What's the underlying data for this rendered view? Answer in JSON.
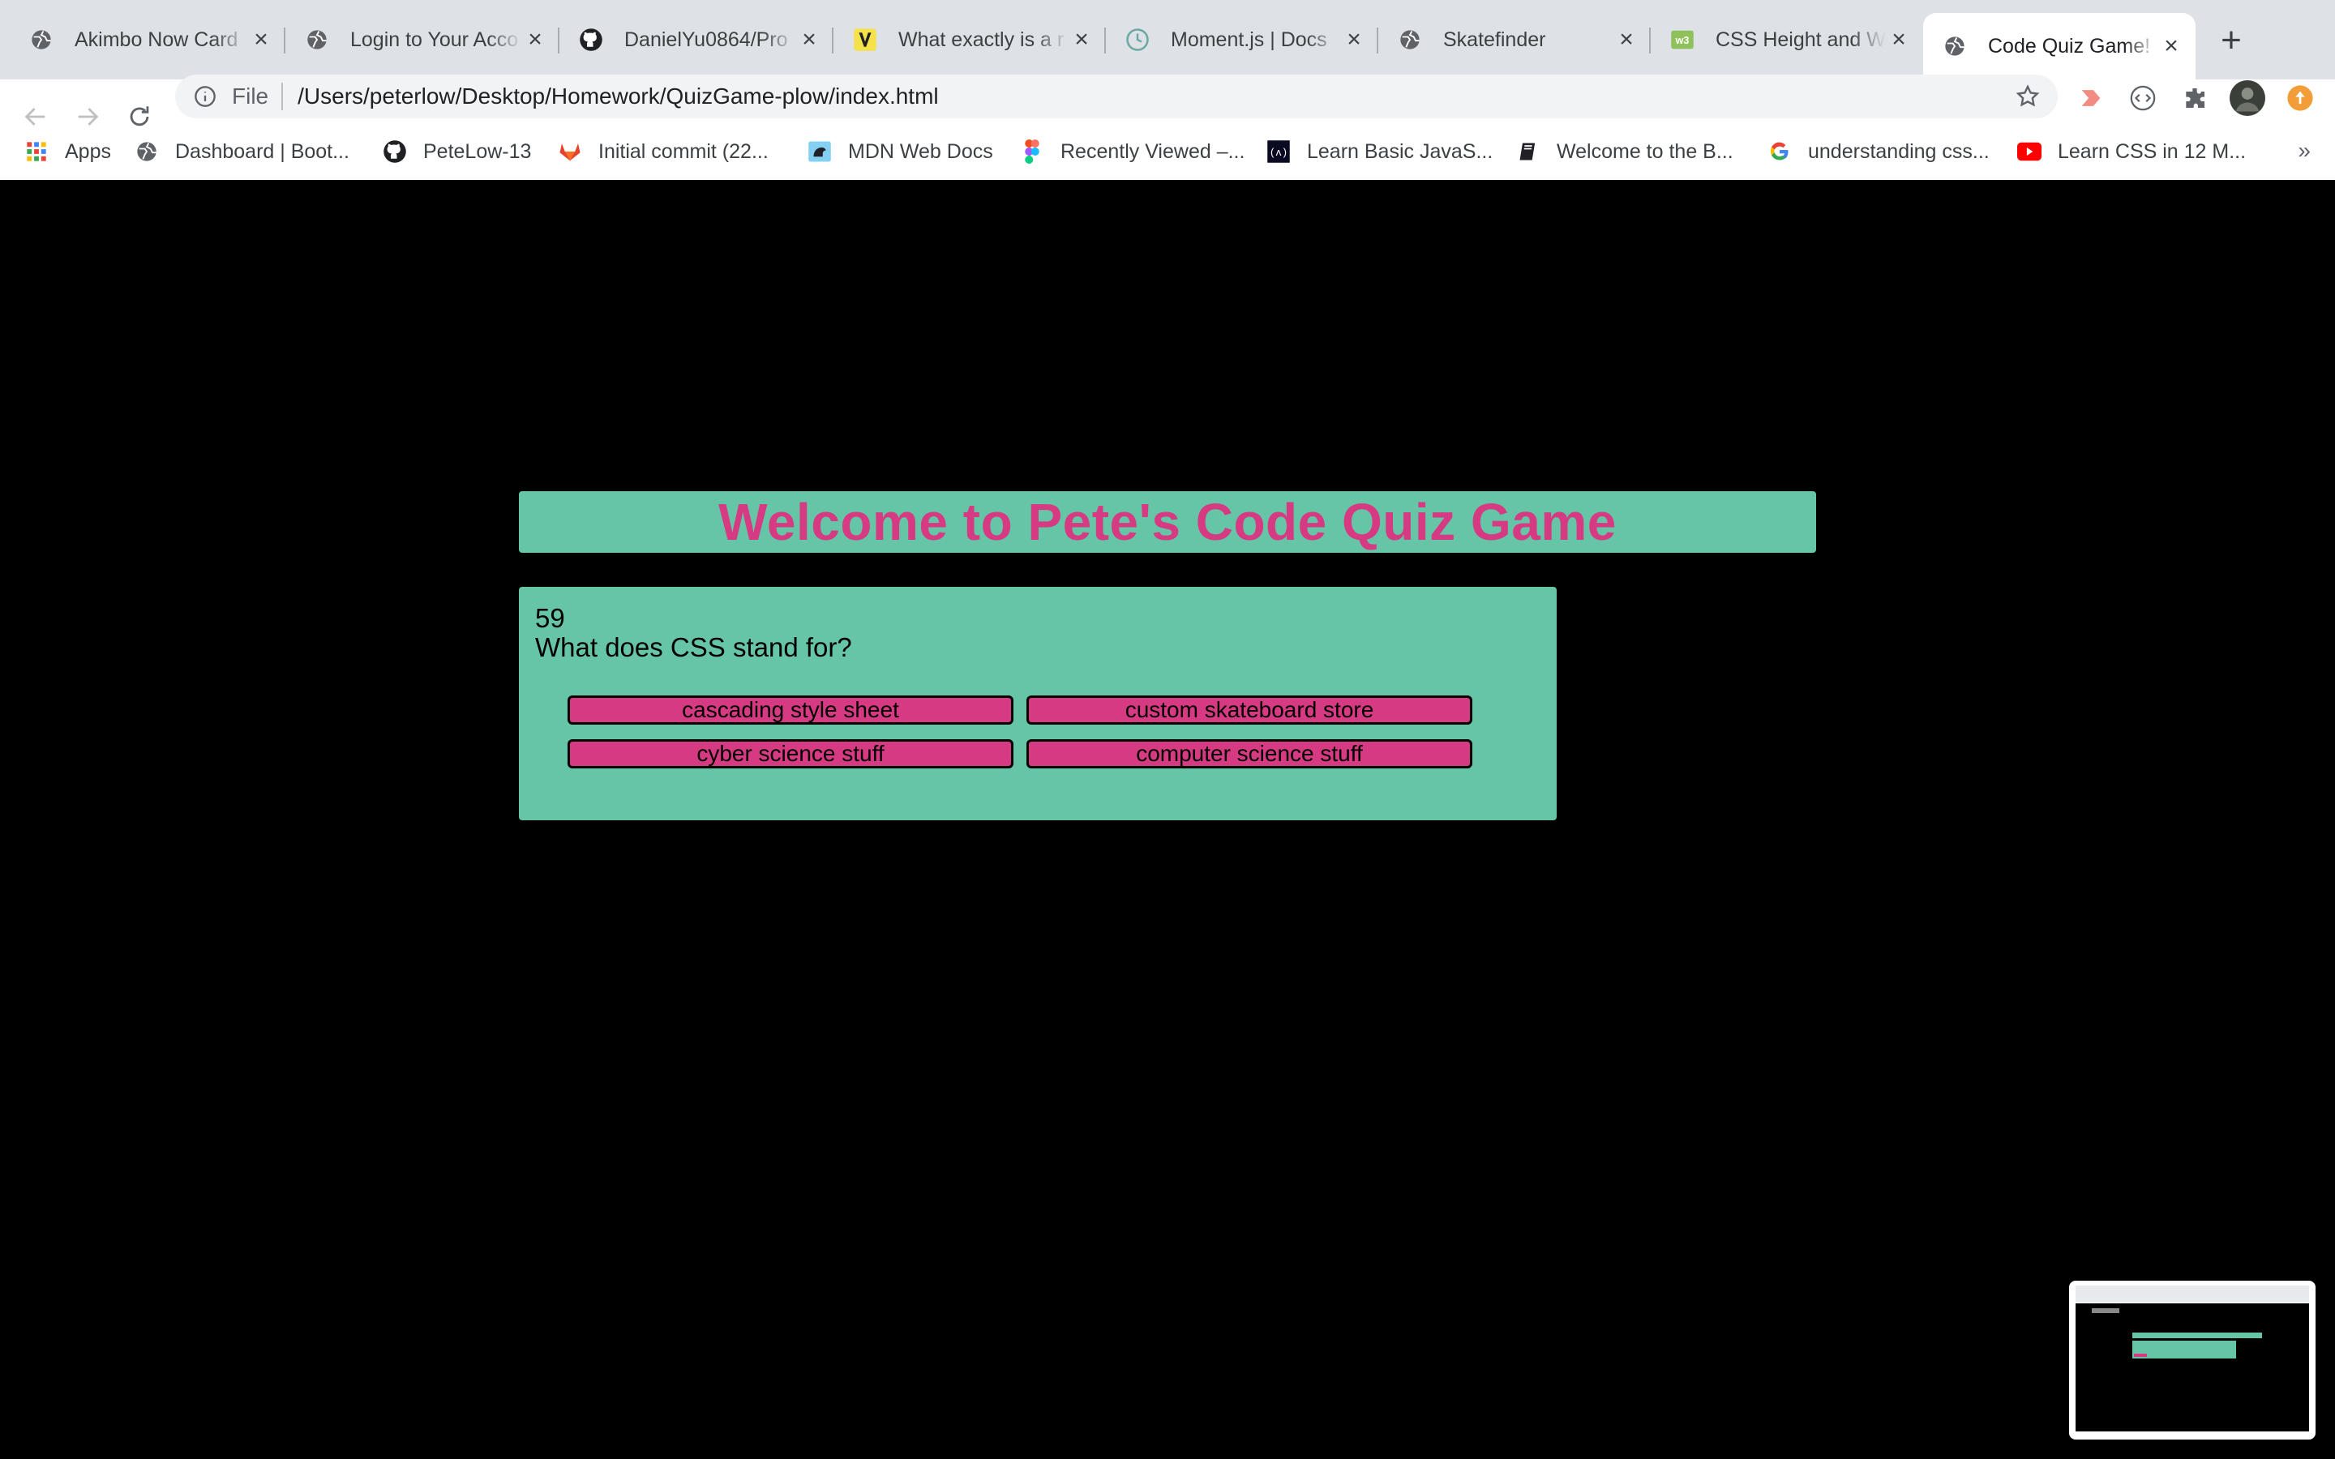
{
  "browser": {
    "tabs": [
      {
        "title": "Akimbo Now Card",
        "favicon": "globe-icon"
      },
      {
        "title": "Login to Your Acco",
        "favicon": "globe-icon"
      },
      {
        "title": "DanielYu0864/Pro",
        "favicon": "github-icon"
      },
      {
        "title": "What exactly is a r",
        "favicon": "v-icon"
      },
      {
        "title": "Moment.js | Docs",
        "favicon": "clock-icon"
      },
      {
        "title": "Skatefinder",
        "favicon": "globe-icon"
      },
      {
        "title": "CSS Height and W",
        "favicon": "w3-icon"
      },
      {
        "title": "Code Quiz Game!",
        "favicon": "globe-icon"
      }
    ],
    "address": {
      "scheme_label": "File",
      "url": "/Users/peterlow/Desktop/Homework/QuizGame-plow/index.html"
    },
    "bookmarks": [
      {
        "label": "Apps",
        "icon": "apps-grid-icon"
      },
      {
        "label": "Dashboard | Boot...",
        "icon": "globe-icon"
      },
      {
        "label": "PeteLow-13",
        "icon": "github-icon"
      },
      {
        "label": "Initial commit (22...",
        "icon": "gitlab-icon"
      },
      {
        "label": "MDN Web Docs",
        "icon": "mdn-icon"
      },
      {
        "label": "Recently Viewed –...",
        "icon": "figma-icon"
      },
      {
        "label": "Learn Basic JavaS...",
        "icon": "freecodecamp-icon"
      },
      {
        "label": "Welcome to the B...",
        "icon": "book-icon"
      },
      {
        "label": "understanding css...",
        "icon": "google-icon"
      },
      {
        "label": "Learn CSS in 12 M...",
        "icon": "youtube-icon"
      }
    ],
    "bookmarks_more": "»"
  },
  "page": {
    "heading": "Welcome to Pete's Code Quiz Game",
    "timer": "59",
    "question": "What does CSS stand for?",
    "answers": [
      "cascading style sheet",
      "custom skateboard store",
      "cyber science stuff",
      "computer science stuff"
    ]
  },
  "colors": {
    "accent_green": "#66c5a6",
    "accent_pink": "#d63a82",
    "page_background": "#000000"
  }
}
